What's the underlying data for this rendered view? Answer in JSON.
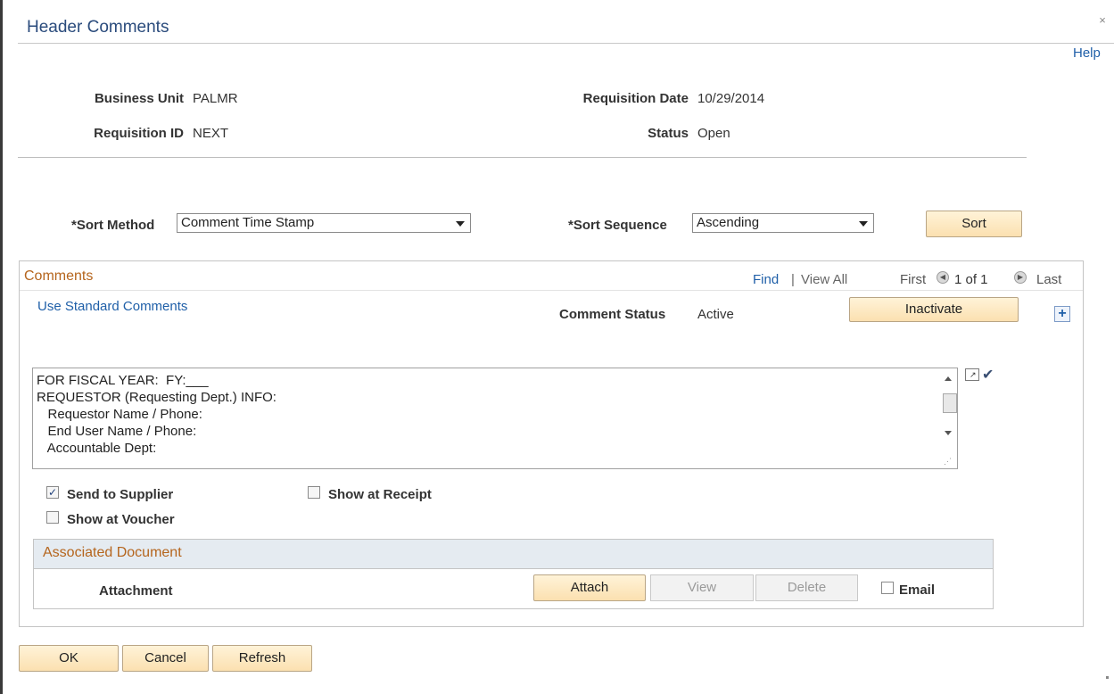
{
  "page": {
    "title": "Header Comments",
    "close_glyph": "×",
    "help_label": "Help"
  },
  "header": {
    "business_unit_label": "Business Unit",
    "business_unit_value": "PALMR",
    "requisition_id_label": "Requisition ID",
    "requisition_id_value": "NEXT",
    "requisition_date_label": "Requisition Date",
    "requisition_date_value": "10/29/2014",
    "status_label": "Status",
    "status_value": "Open"
  },
  "sort": {
    "method_label": "*Sort Method",
    "method_value": "Comment Time Stamp",
    "sequence_label": "*Sort Sequence",
    "sequence_value": "Ascending",
    "sort_button": "Sort"
  },
  "comments": {
    "section_title": "Comments",
    "find_link": "Find",
    "separator": "|",
    "view_all_link": "View All",
    "first_label": "First",
    "page_count": "1 of 1",
    "last_label": "Last",
    "use_standard_link": "Use Standard Comments",
    "comment_status_label": "Comment Status",
    "comment_status_value": "Active",
    "inactivate_button": "Inactivate",
    "add_row_glyph": "+",
    "text_lines": [
      "FOR FISCAL YEAR:  FY:___",
      "REQUESTOR (Requesting Dept.) INFO:",
      "   Requestor Name / Phone:",
      "   End User Name / Phone:",
      "   Accountable Dept:"
    ],
    "send_to_supplier_label": "Send to Supplier",
    "send_to_supplier_checked": true,
    "show_at_receipt_label": "Show at Receipt",
    "show_at_receipt_checked": false,
    "show_at_voucher_label": "Show at Voucher",
    "show_at_voucher_checked": false
  },
  "associated_document": {
    "section_title": "Associated Document",
    "attachment_label": "Attachment",
    "attach_button": "Attach",
    "view_button": "View",
    "delete_button": "Delete",
    "email_label": "Email",
    "email_checked": false
  },
  "footer": {
    "ok_button": "OK",
    "cancel_button": "Cancel",
    "refresh_button": "Refresh"
  },
  "colors": {
    "title_blue": "#2a4b7c",
    "link_blue": "#1f5fa8",
    "section_orange": "#b5651d",
    "button_fill": "#fbe0b0"
  }
}
